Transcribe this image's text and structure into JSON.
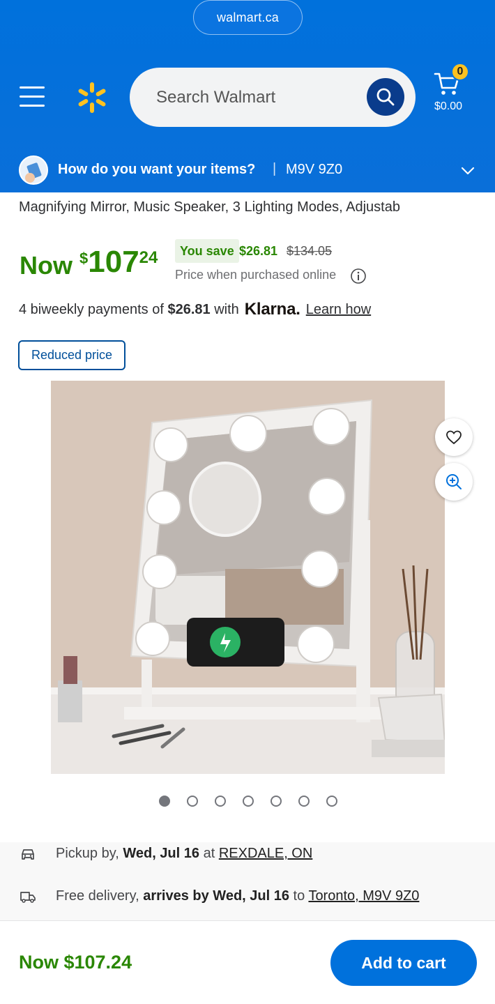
{
  "browser": {
    "url": "walmart.ca"
  },
  "header": {
    "search_placeholder": "Search Walmart",
    "cart_count": "0",
    "cart_total": "$0.00",
    "delivery_question": "How do you want your items?",
    "delivery_separator": "|",
    "postal_code": "M9V 9Z0"
  },
  "product": {
    "title": "Magnifying Mirror, Music Speaker, 3 Lighting Modes, Adjustab",
    "now_label": "Now",
    "price_currency": "$",
    "price_dollars": "107",
    "price_cents": "24",
    "you_save_label": "You save",
    "save_amount": "$26.81",
    "was_price": "$134.05",
    "online_note": "Price when purchased online",
    "klarna_prefix": "4 biweekly payments of",
    "klarna_amount": "$26.81",
    "klarna_with": "with",
    "klarna_brand": "Klarna.",
    "klarna_learn": "Learn how",
    "badge": "Reduced price",
    "image_count": 7,
    "active_image": 1
  },
  "fulfillment": {
    "pickup": {
      "prefix": "Pickup by,",
      "date": "Wed, Jul 16",
      "at": "at",
      "store": "REXDALE, ON"
    },
    "delivery": {
      "prefix": "Free delivery,",
      "date": "arrives by Wed, Jul 16",
      "to": "to",
      "location": "Toronto, M9V 9Z0"
    }
  },
  "bottom_bar": {
    "price": "Now $107.24",
    "add_to_cart": "Add to cart"
  },
  "colors": {
    "brand_blue": "#0071dc",
    "spark_yellow": "#ffc220",
    "price_green": "#2a8703"
  }
}
